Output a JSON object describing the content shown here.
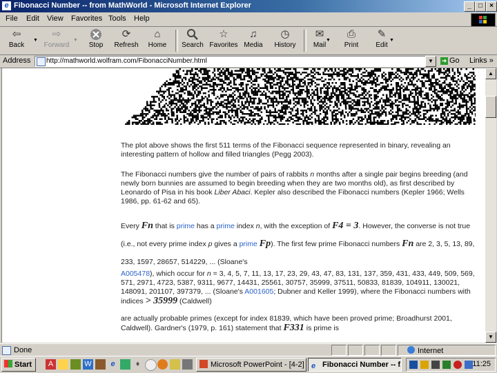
{
  "window": {
    "title": "Fibonacci Number -- from MathWorld - Microsoft Internet Explorer",
    "buttons": [
      "_",
      "□",
      "×"
    ]
  },
  "menu": [
    "File",
    "Edit",
    "View",
    "Favorites",
    "Tools",
    "Help"
  ],
  "toolbar": {
    "back": "Back",
    "forward": "Forward",
    "stop": "Stop",
    "refresh": "Refresh",
    "home": "Home",
    "search": "Search",
    "favorites": "Favorites",
    "media": "Media",
    "history": "History",
    "mail": "Mail",
    "print": "Print",
    "edit": "Edit"
  },
  "address": {
    "label": "Address",
    "url": "http://mathworld.wolfram.com/FibonacciNumber.html",
    "go": "Go",
    "links": "Links »"
  },
  "content": {
    "p1": "The plot above shows the first 511 terms of the Fibonacci sequence represented in binary, revealing an interesting pattern of hollow and filled triangles (Pegg 2003).",
    "p2a": "The Fibonacci numbers give the number of pairs of rabbits ",
    "p2n": "n",
    "p2b": " months after a single pair begins breeding (and newly born bunnies are assumed to begin breeding when they are two months old), as first described by Leonardo of Pisa in his book ",
    "p2book": "Liber Abaci",
    "p2c": ". Kepler also described the Fibonacci numbers (Kepler 1966; Wells 1986, pp. 61-62 and 65).",
    "p3a": "Every ",
    "p3Fn": "Fn",
    "p3b": " that is ",
    "p3prime1": "prime",
    "p3c": " has a ",
    "p3prime2": "prime",
    "p3d": " index ",
    "p3n": "n",
    "p3e": ", with the exception of ",
    "p3F4": "F4 = 3",
    "p3f": ". However, the converse is not true (i.e., not every prime index ",
    "p3p": "p",
    "p3g": " gives a ",
    "p3prime3": "prime",
    "p3Fp": "Fp",
    "p3h": "). The first few prime Fibonacci numbers ",
    "p3Fn2": "Fn",
    "p3i": " are 2, 3, 5, 13, 89, 233, 1597, 28657, 514229, ... (Sloane's",
    "p3a1": "A005478",
    "p3j": "), which occur for ",
    "p3n2": "n",
    "p3k": " = 3, 4, 5, 7, 11, 13, 17, 23, 29, 43, 47, 83, 131, 137, 359, 431, 433, 449, 509, 569, 571, 2971, 4723, 5387, 9311, 9677, 14431, 25561, 30757, 35999, 37511, 50833, 81839, 104911, 130021, 148091, 201107, 397379, ... (Sloane's ",
    "p3a2": "A001605",
    "p3l": "; Dubner and Keller 1999), where the Fibonacci numbers with indices ",
    "p3gt": "> 35999",
    "p3m": " (Caldwell)",
    "p4a": "are actually probable primes (except for index 81839, which have been proved prime; Broadhurst 2001, Caldwell). Gardner's (1979, p. 161) statement that ",
    "p4F": "F331",
    "p4b": " is prime is"
  },
  "status": {
    "text": "Done",
    "zone": "Internet"
  },
  "taskbar": {
    "start": "Start",
    "tasks": [
      "Microsoft PowerPoint - [4-2]",
      "Fibonacci Number -- f..."
    ],
    "clock": "11:25"
  }
}
